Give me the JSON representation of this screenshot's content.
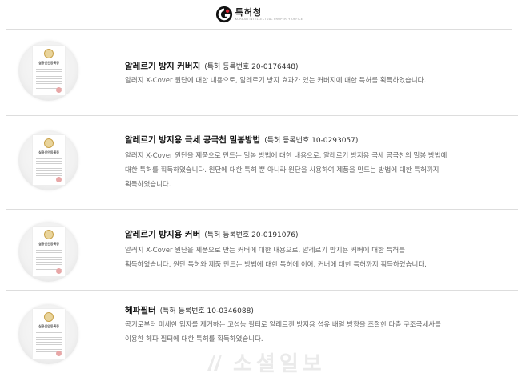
{
  "header": {
    "logo_text": "특허청",
    "logo_subtext": "KOREAN INTELLECTUAL PROPERTY OFFICE",
    "logo_icon": "kipo-logo-icon"
  },
  "certificate": {
    "title": "실용신안등록증",
    "icon": "certificate-icon"
  },
  "patents": [
    {
      "title": "알레르기 방지 커버지",
      "reg": "(특허 등록번호 20-0176448)",
      "desc": [
        "알러지 X-Cover 원단에 대한 내용으로, 알레르기 방지 효과가 있는 커버지에 대한 특허를 획득하였습니다."
      ]
    },
    {
      "title": "알레르기 방지용 극세 공극천 밀봉방법",
      "reg": "(특허 등록번호 10-0293057)",
      "desc": [
        "알러지 X-Cover 원단을 제품으로 만드는 밀봉 방법에 대한 내용으로, 알레르기 방지용 극세 공극천의 밀봉 방법에",
        "대한 특허를 획득하였습니다. 원단에 대한 특허 뿐 아니라 원단을 사용하여 제품을 만드는 방법에 대한 특허까지",
        "획득하였습니다."
      ]
    },
    {
      "title": "알레르기 방지용 커버",
      "reg": "(특허 등록번호 20-0191076)",
      "desc": [
        "알러지 X-Cover 원단을 제품으로 만든 커버에 대한 내용으로, 알레르기 방지용 커버에 대한 특허를",
        "획득하였습니다. 원단 특허와 제품 만드는 방법에 대한 특허에 이어, 커버에 대한 특허까지 획득하였습니다."
      ]
    },
    {
      "title": "헤파필터",
      "reg": "(특허 등록번호 10-0346088)",
      "desc": [
        "공기로부터 미세한 입자를 제거하는 고성능 필터로 알레르겐 방지용 섬유 배열 방향을 조절한 다층 구조극세사를",
        "이용한 헤파 필터에 대한 특허를 획득하였습니다."
      ]
    }
  ],
  "watermark": {
    "text": "소셜일보"
  }
}
